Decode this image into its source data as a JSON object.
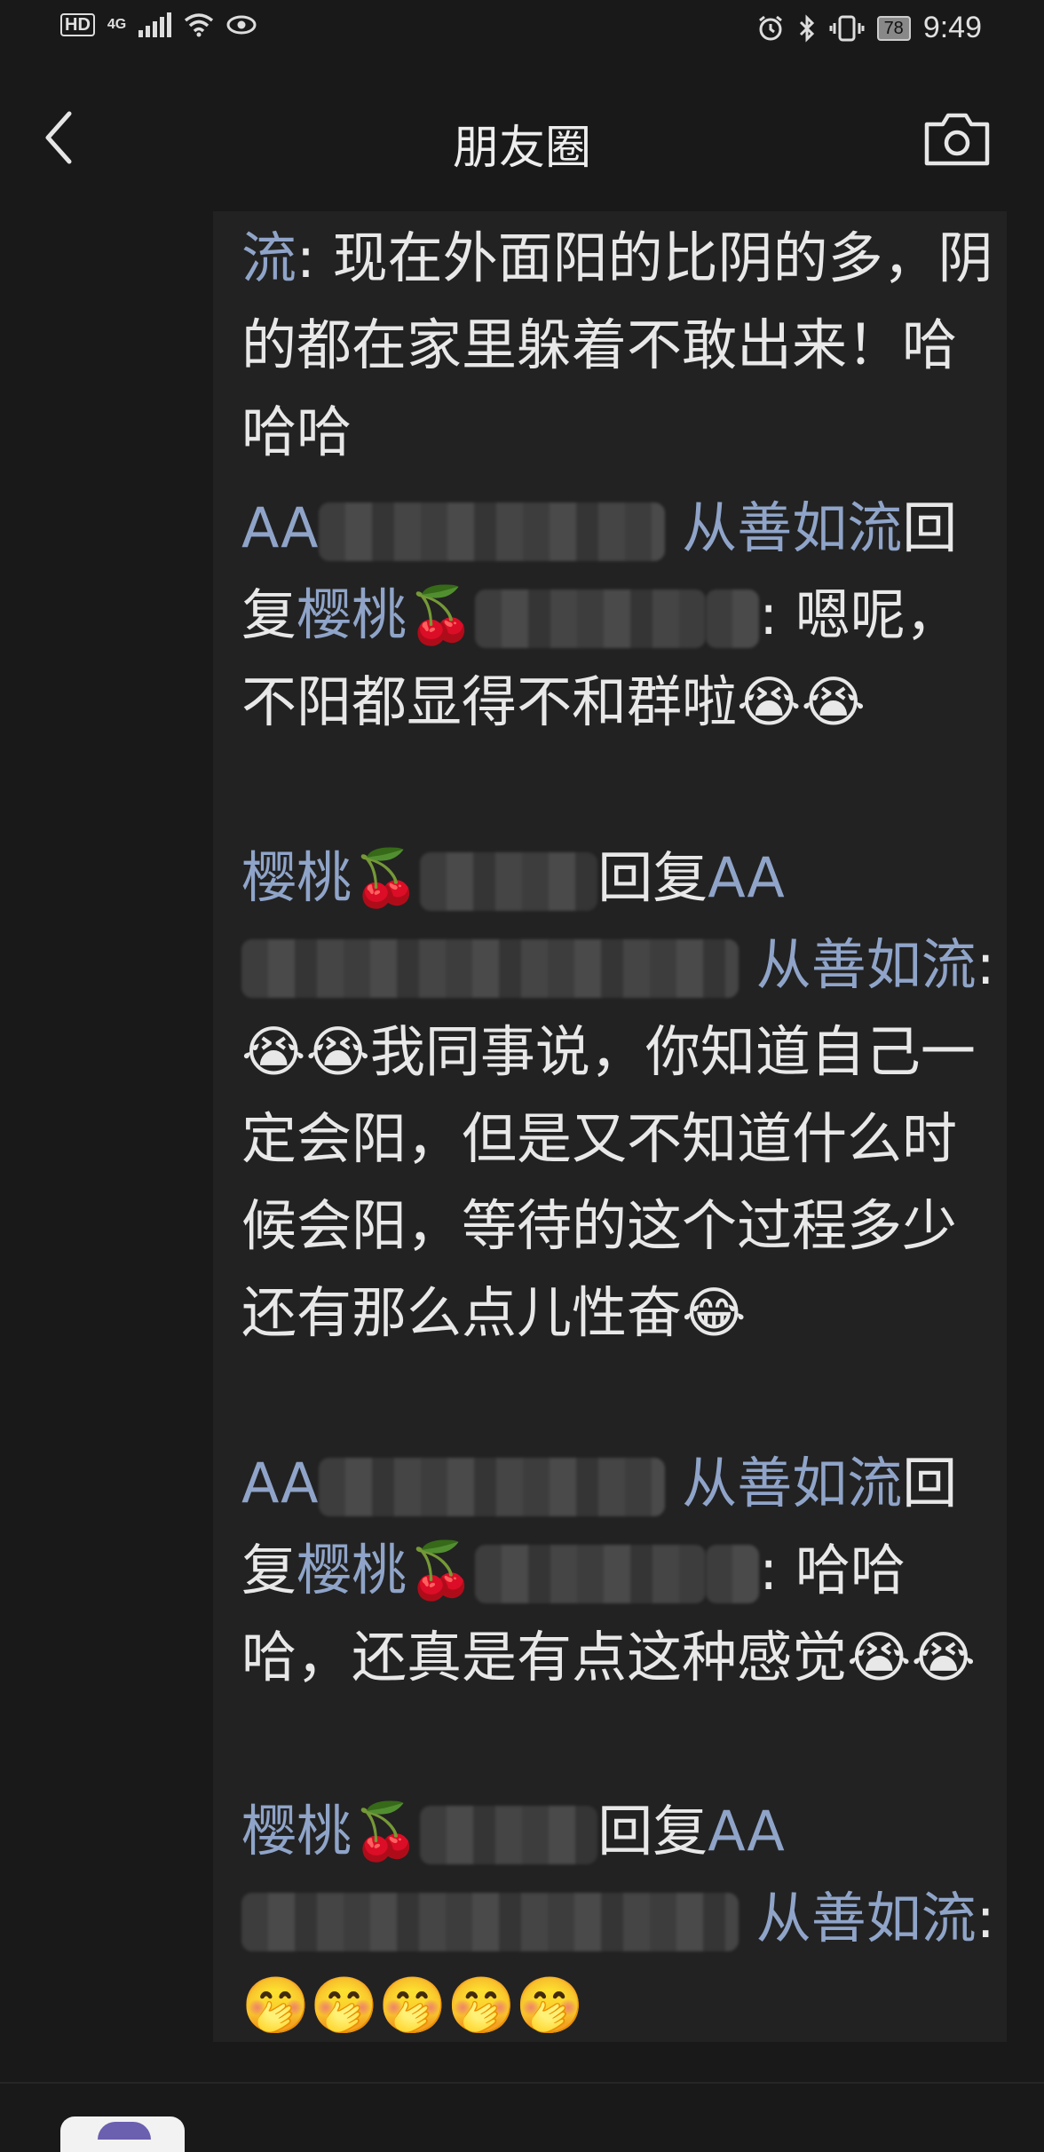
{
  "status_bar": {
    "hd": "HD",
    "network": "4G",
    "battery": "78",
    "time": "9:49"
  },
  "nav": {
    "title": "朋友圈",
    "back_icon": "chevron-left-icon",
    "camera_icon": "camera-icon"
  },
  "comments": [
    {
      "author_tail": "流",
      "text": "现在外面阳的比阴的多，阴的都在家里躲着不敢出来！哈哈哈"
    },
    {
      "author_a": "AA",
      "author_b": "从善如流",
      "reply_word": "回复",
      "reply_to": "樱桃🍒",
      "text": "嗯呢，不阳都显得不和群啦😭😭"
    },
    {
      "author": "樱桃🍒",
      "reply_word": "回复",
      "reply_to_a": "AA",
      "reply_to_b": "从善如流",
      "text": "😭😭我同事说，你知道自己一定会阳，但是又不知道什么时候会阳，等待的这个过程多少还有那么点儿性奋😂"
    },
    {
      "author_a": "AA",
      "author_b": "从善如流",
      "reply_word": "回复",
      "reply_to": "樱桃🍒",
      "text": "哈哈哈，还真是有点这种感觉😭😭"
    },
    {
      "author": "樱桃🍒",
      "reply_word": "回复",
      "reply_to_a": "AA",
      "reply_to_b": "从善如流",
      "text": "🤭🤭🤭🤭🤭"
    }
  ],
  "colors": {
    "background": "#191919",
    "panel": "#222222",
    "name": "#8fa4c8",
    "text": "#e8e8e8"
  }
}
